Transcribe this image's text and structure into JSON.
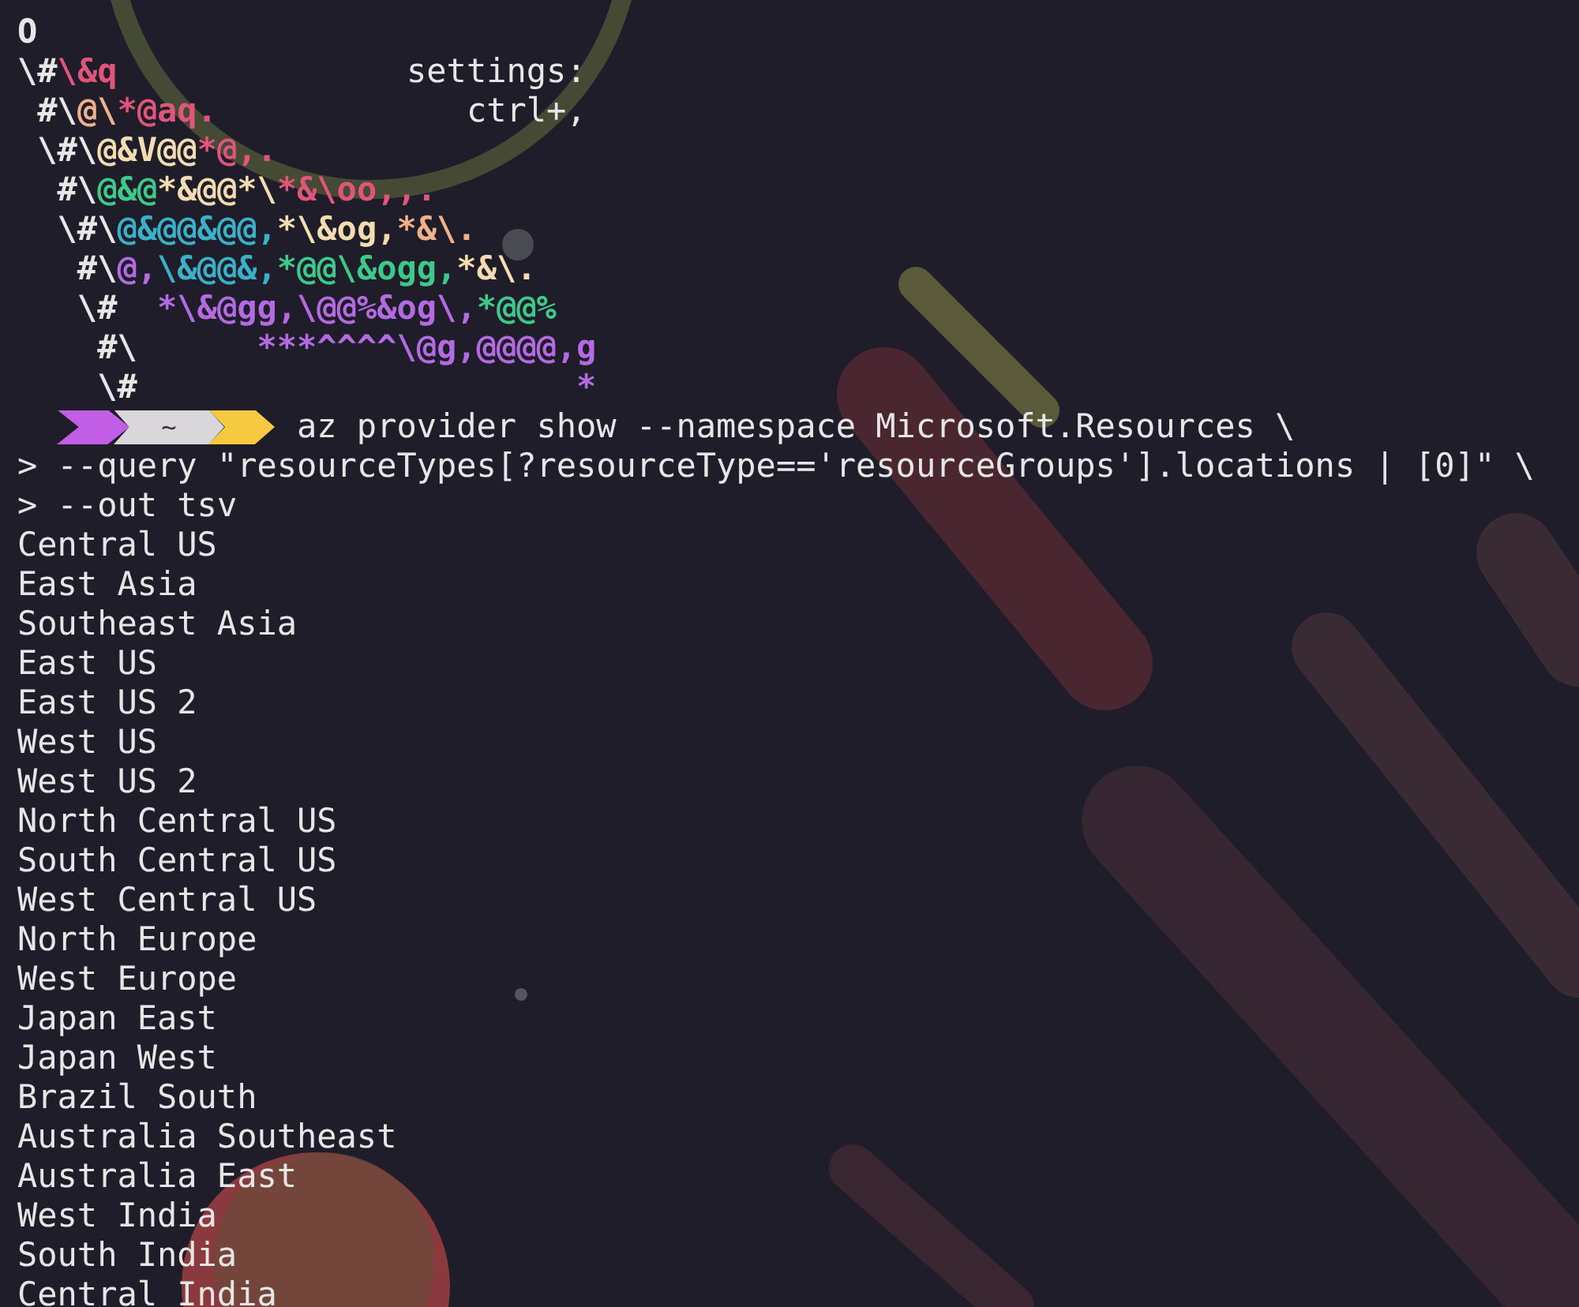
{
  "art_lines": [
    [
      {
        "text": "O",
        "color": "#e6e6e6"
      }
    ],
    [
      {
        "text": "\\#",
        "color": "#e6e6e6"
      },
      {
        "text": "\\&q",
        "color": "#e0557a"
      }
    ],
    [
      {
        "text": " #\\",
        "color": "#e6e6e6"
      },
      {
        "text": "@\\",
        "color": "#f0b08a"
      },
      {
        "text": "*@aq.",
        "color": "#e0557a"
      }
    ],
    [
      {
        "text": " \\#\\",
        "color": "#e6e6e6"
      },
      {
        "text": "@&V@@",
        "color": "#f2dcb0"
      },
      {
        "text": "*@,.",
        "color": "#e0557a"
      }
    ],
    [
      {
        "text": "  #\\",
        "color": "#e6e6e6"
      },
      {
        "text": "@&@",
        "color": "#3ec98a"
      },
      {
        "text": "*&@@*\\",
        "color": "#f2dcb0"
      },
      {
        "text": "*&\\oo,,.",
        "color": "#e0557a"
      }
    ],
    [
      {
        "text": "  \\#\\",
        "color": "#e6e6e6"
      },
      {
        "text": "@&@@&@@,",
        "color": "#3bb0c9"
      },
      {
        "text": "*\\&og,",
        "color": "#f2dcb0"
      },
      {
        "text": "*&\\.",
        "color": "#f0b08a"
      }
    ],
    [
      {
        "text": "   #\\",
        "color": "#e6e6e6"
      },
      {
        "text": "@,",
        "color": "#b46ae0"
      },
      {
        "text": "\\&@@&,",
        "color": "#3bb0c9"
      },
      {
        "text": "*@@\\&ogg,",
        "color": "#3ec98a"
      },
      {
        "text": "*&\\.",
        "color": "#f2dcb0"
      }
    ],
    [
      {
        "text": "   \\#  ",
        "color": "#e6e6e6"
      },
      {
        "text": "*\\&@gg,\\@@%&og\\,",
        "color": "#b46ae0"
      },
      {
        "text": "*@@%",
        "color": "#3ec98a"
      }
    ],
    [
      {
        "text": "    #\\      ",
        "color": "#e6e6e6"
      },
      {
        "text": "***^^^^\\@g,@@@@,g",
        "color": "#b46ae0"
      }
    ],
    [
      {
        "text": "    \\#                      ",
        "color": "#e6e6e6"
      },
      {
        "text": "*",
        "color": "#b46ae0"
      }
    ]
  ],
  "settings_hint": [
    "settings:",
    "ctrl+,"
  ],
  "prompt": {
    "path": "~",
    "command": "az provider show --namespace Microsoft.Resources \\"
  },
  "continuation_lines": [
    {
      "marker": ">",
      "text": "--query \"resourceTypes[?resourceType=='resourceGroups'].locations | [0]\" \\"
    },
    {
      "marker": ">",
      "text": "--out tsv"
    }
  ],
  "output_lines": [
    "Central US",
    "East Asia",
    "Southeast Asia",
    "East US",
    "East US 2",
    "West US",
    "West US 2",
    "North Central US",
    "South Central US",
    "West Central US",
    "North Europe",
    "West Europe",
    "Japan East",
    "Japan West",
    "Brazil South",
    "Australia Southeast",
    "Australia East",
    "West India",
    "South India",
    "Central India"
  ]
}
